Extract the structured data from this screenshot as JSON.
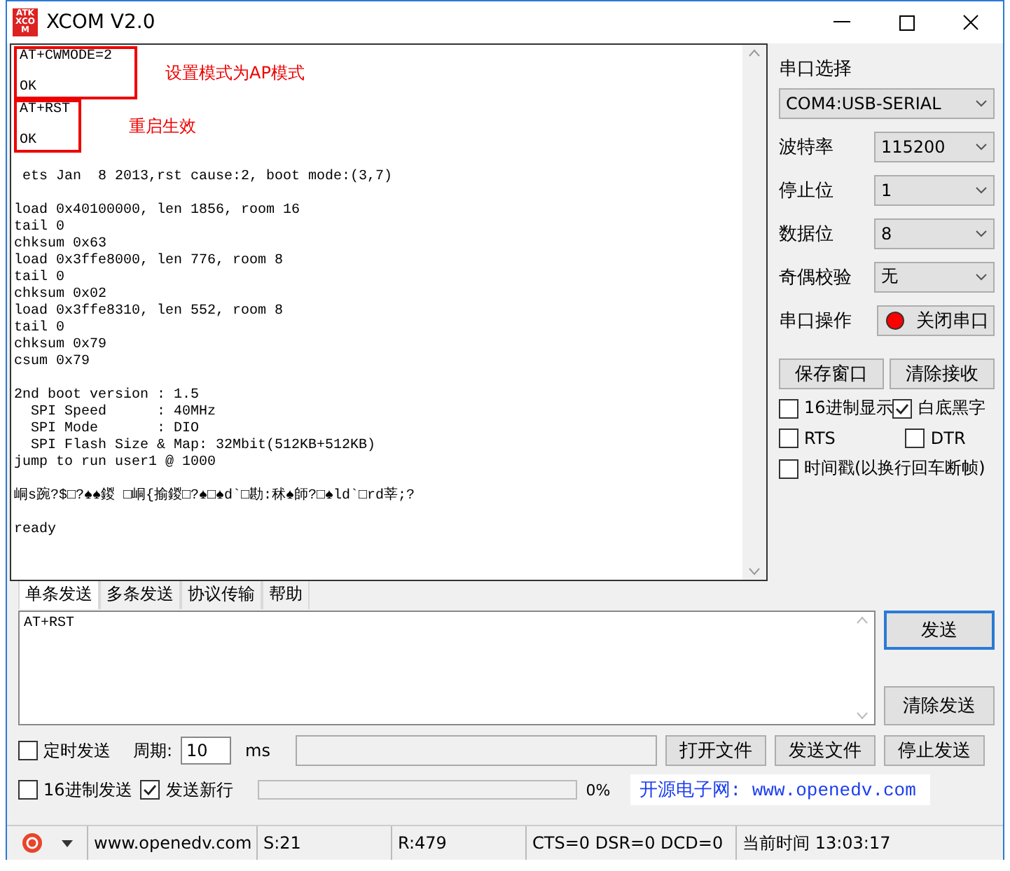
{
  "window": {
    "title": "XCOM V2.0",
    "logo": "ATK XCOM"
  },
  "receive": {
    "frames": [
      {
        "lines": [
          "AT+CWMODE=2",
          "OK"
        ],
        "note": "设置模式为AP模式"
      },
      {
        "lines": [
          "AT+RST",
          "OK"
        ],
        "note": "重启生效"
      }
    ],
    "blocks": [
      {
        "lines": [
          " ets Jan  8 2013,rst cause:2, boot mode:(3,7)"
        ]
      },
      {
        "lines": [
          "load 0x40100000, len 1856, room 16",
          "tail 0",
          "chksum 0x63",
          "load 0x3ffe8000, len 776, room 8",
          "tail 0",
          "chksum 0x02",
          "load 0x3ffe8310, len 552, room 8",
          "tail 0",
          "chksum 0x79",
          "csum 0x79"
        ]
      },
      {
        "lines": [
          "2nd boot version : 1.5",
          "  SPI Speed      : 40MHz",
          "  SPI Mode       : DIO",
          "  SPI Flash Size & Map: 32Mbit(512KB+512KB)",
          "jump to run user1 @ 1000"
        ]
      },
      {
        "lines": [
          "峒s踠?$□?♠♠鍐 □峒{揄鍐□?♠□♠d`□勘:秫♠師?□♠ld`□rd莘;?"
        ]
      },
      {
        "lines": [
          "ready"
        ]
      }
    ]
  },
  "serial": {
    "port_label": "串口选择",
    "port": "COM4:USB-SERIAL",
    "settings": [
      {
        "label": "波特率",
        "value": "115200"
      },
      {
        "label": "停止位",
        "value": "1"
      },
      {
        "label": "数据位",
        "value": "8"
      },
      {
        "label": "奇偶校验",
        "value": "无"
      }
    ],
    "operation_label": "串口操作",
    "operation_button": "关闭串口",
    "port_open": true
  },
  "receive_buttons": [
    "保存窗口",
    "清除接收"
  ],
  "receive_options": [
    {
      "label": "16进制显示",
      "checked": false
    },
    {
      "label": "白底黑字",
      "checked": true
    },
    {
      "label": "RTS",
      "checked": false
    },
    {
      "label": "DTR",
      "checked": false
    },
    {
      "label": "时间戳(以换行回车断帧)",
      "checked": false
    }
  ],
  "tabs": [
    {
      "label": "单条发送",
      "selected": true
    },
    {
      "label": "多条发送",
      "selected": false
    },
    {
      "label": "协议传输",
      "selected": false
    },
    {
      "label": "帮助",
      "selected": false
    }
  ],
  "send": {
    "text": "AT+RST",
    "send_button": "发送",
    "clear_button": "清除发送",
    "timed": {
      "label": "定时发送",
      "checked": false
    },
    "period_label": "周期:",
    "period": "10",
    "period_unit": "ms",
    "hex": {
      "label": "16进制发送",
      "checked": false
    },
    "newline": {
      "label": "发送新行",
      "checked": true
    },
    "file_buttons": [
      "打开文件",
      "发送文件",
      "停止发送"
    ],
    "progress": {
      "level": 0,
      "reading": "0%"
    },
    "banner": "开源电子网: www.openedv.com"
  },
  "status_bar": {
    "website": "www.openedv.com",
    "sent": "S:21",
    "received": "R:479",
    "lines": "CTS=0 DSR=0 DCD=0",
    "time": "当前时间 13:03:17"
  }
}
